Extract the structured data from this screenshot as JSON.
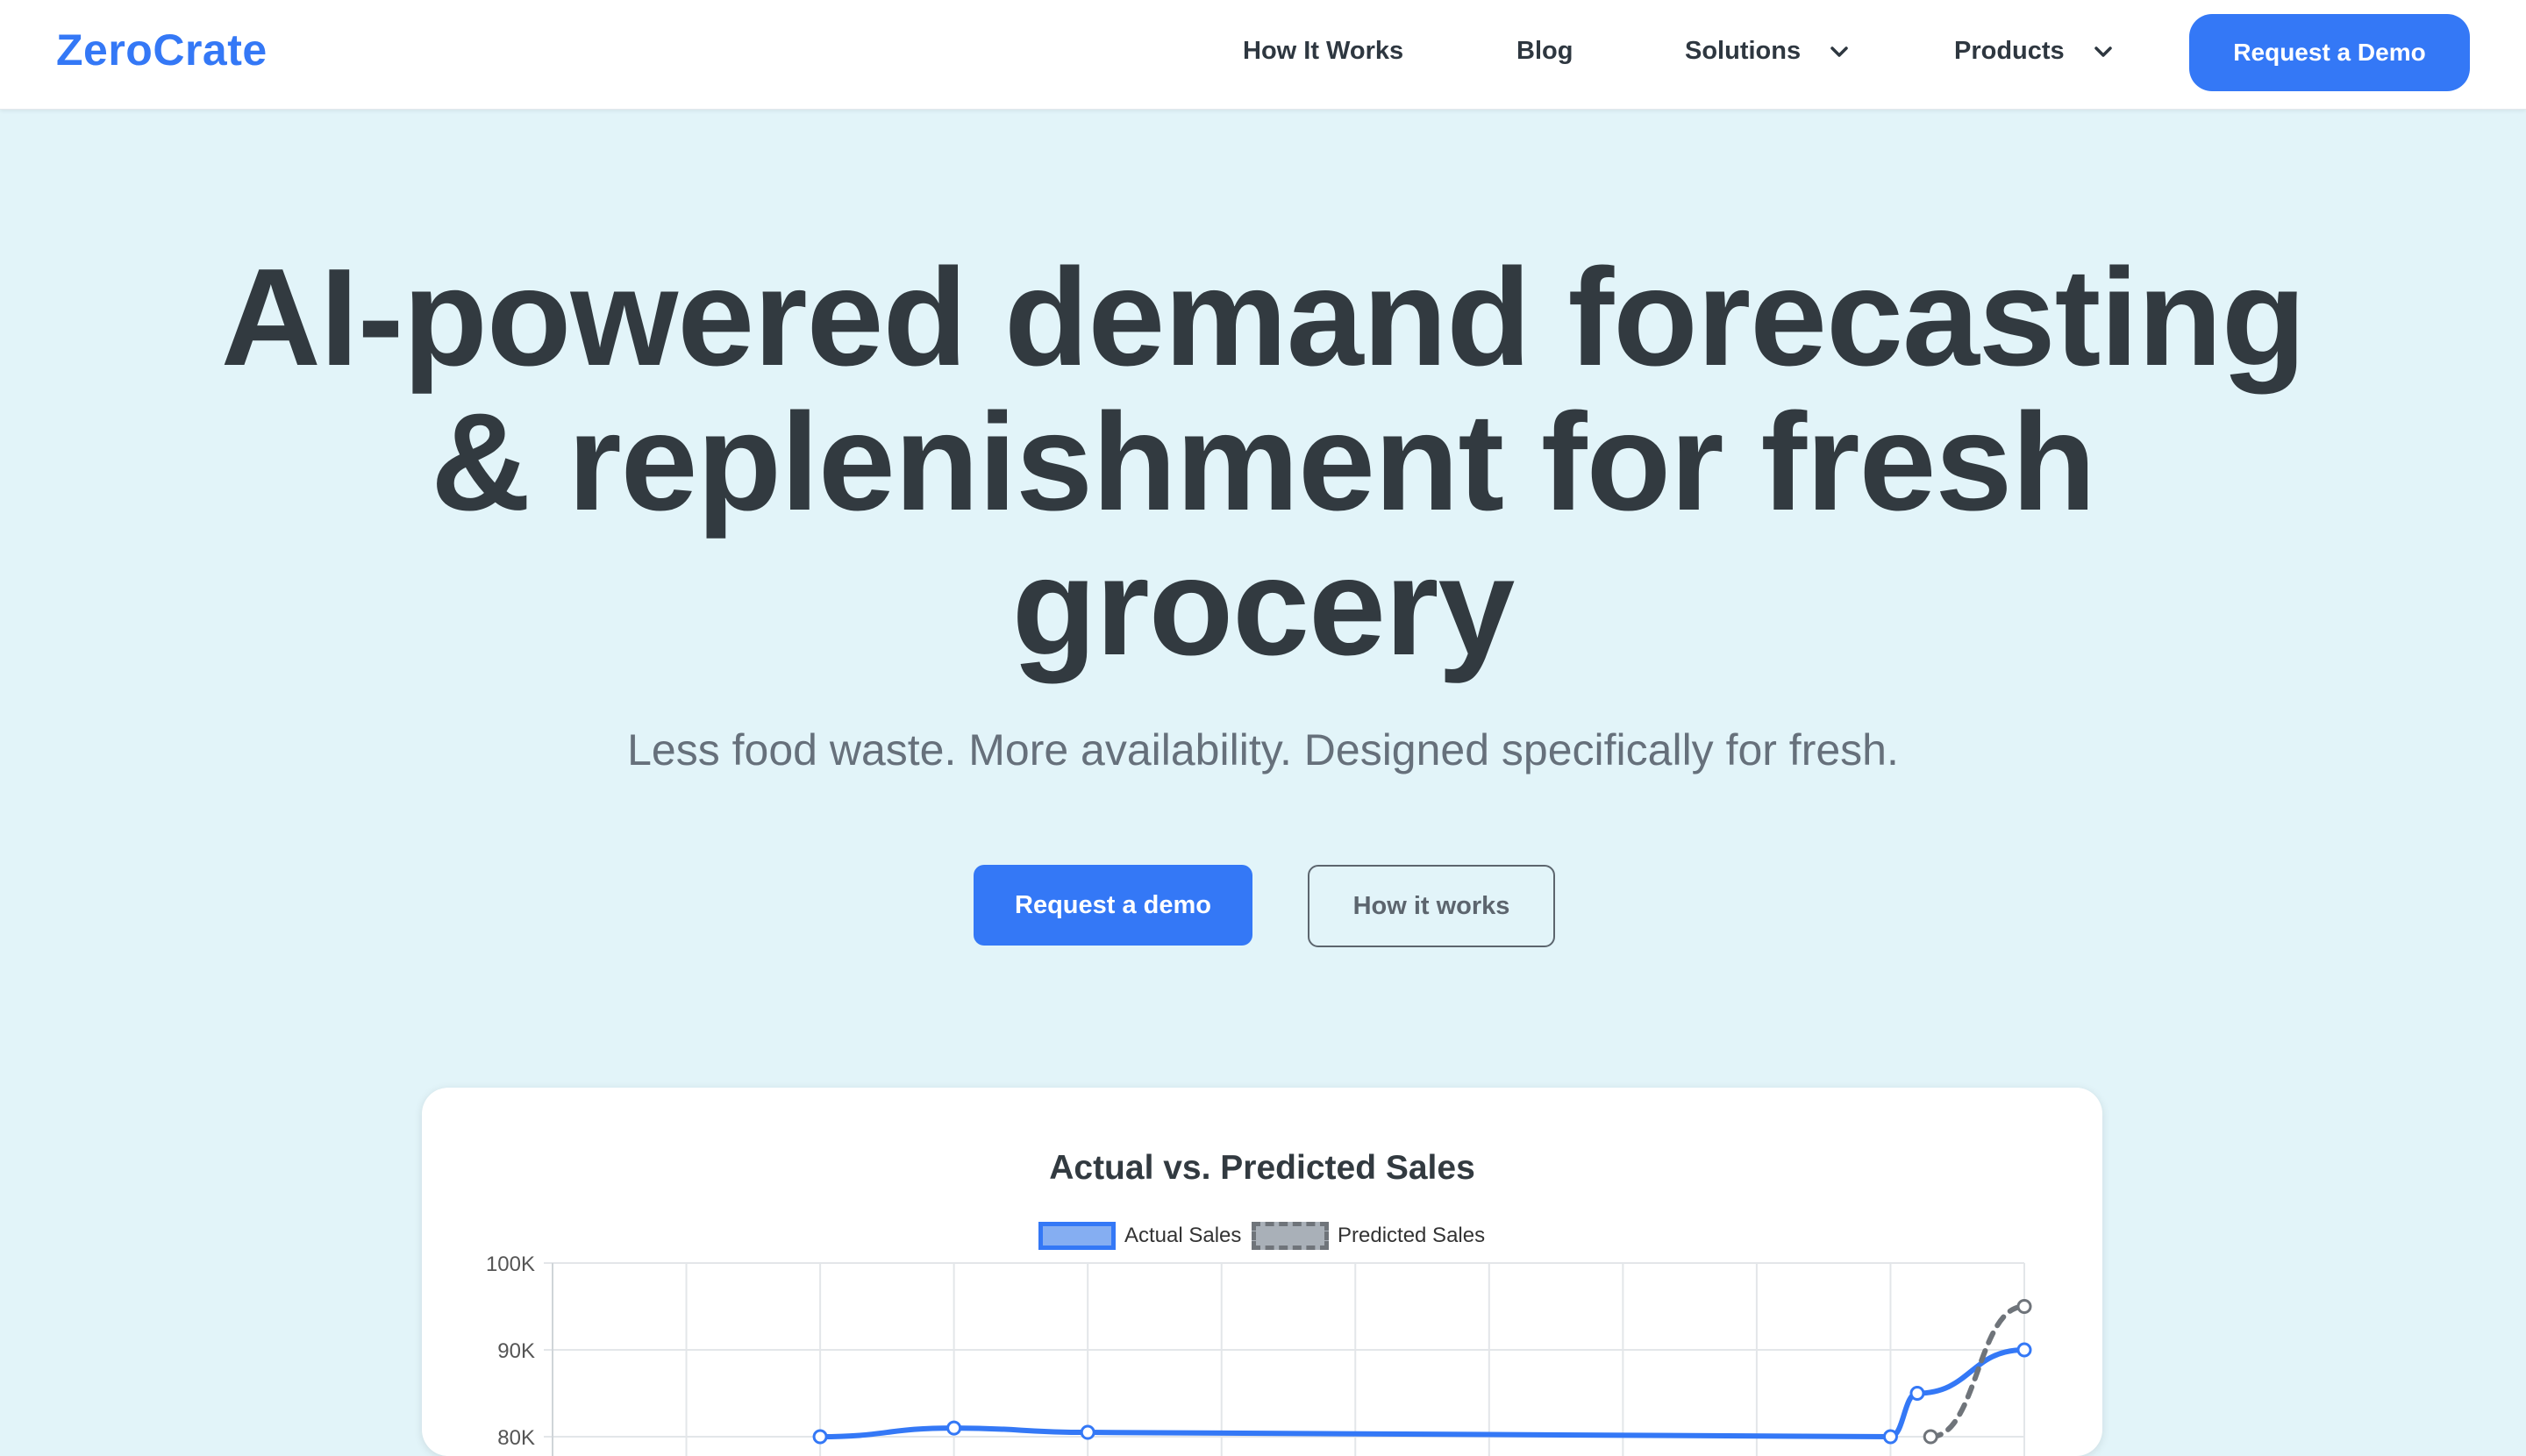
{
  "brand": {
    "name": "ZeroCrate",
    "color": "#3478f6"
  },
  "nav": {
    "links": [
      "How It Works",
      "Blog",
      "Solutions",
      "Products"
    ],
    "cta": "Request a Demo"
  },
  "hero": {
    "title": "AI-powered demand forecasting & replenishment for fresh grocery",
    "subtitle": "Less food waste. More availability. Designed specifically for fresh.",
    "primary_cta": "Request a demo",
    "secondary_cta": "How it works"
  },
  "chart_data": {
    "type": "line",
    "title": "Actual vs. Predicted Sales",
    "ylim": [
      80000,
      100000
    ],
    "y_ticks": [
      "100K",
      "90K",
      "80K"
    ],
    "grid": true,
    "legend_placement": "top",
    "series": [
      {
        "name": "Actual Sales",
        "color": "#3478f6",
        "style": "solid",
        "points": [
          [
            2,
            80000
          ],
          [
            3,
            81000
          ],
          [
            4,
            80500
          ],
          [
            10,
            80000
          ],
          [
            10.2,
            85000
          ],
          [
            11,
            90000
          ]
        ]
      },
      {
        "name": "Predicted Sales",
        "color": "#6f747a",
        "style": "dashed",
        "points": [
          [
            10.3,
            80000
          ],
          [
            11,
            95000
          ]
        ]
      }
    ],
    "x_count": 12
  }
}
